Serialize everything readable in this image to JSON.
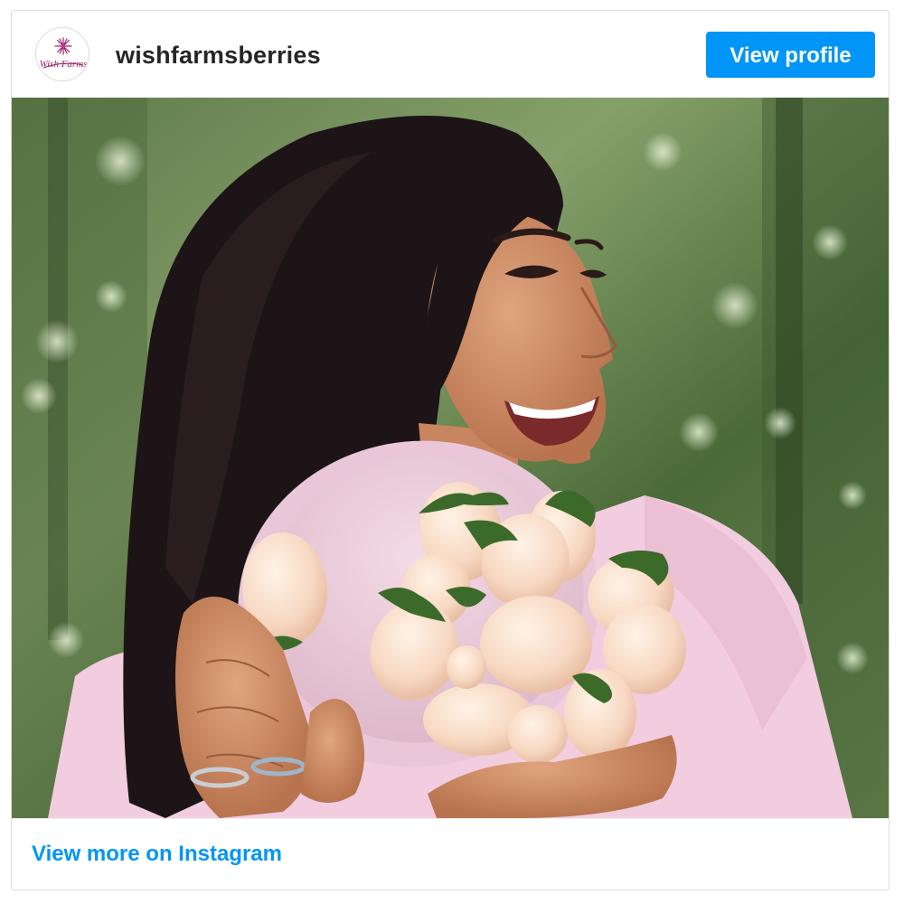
{
  "post": {
    "username": "wishfarmsberries",
    "avatar_logo_text": "Wish Farms",
    "view_profile_label": "View profile",
    "view_more_label": "View more on Instagram",
    "photo_subject": "woman-holding-bowl-of-white-strawberries"
  },
  "colors": {
    "accent": "#0095f6",
    "username": "#262626",
    "border": "#dbdbdb",
    "brand_magenta": "#a0206e"
  }
}
